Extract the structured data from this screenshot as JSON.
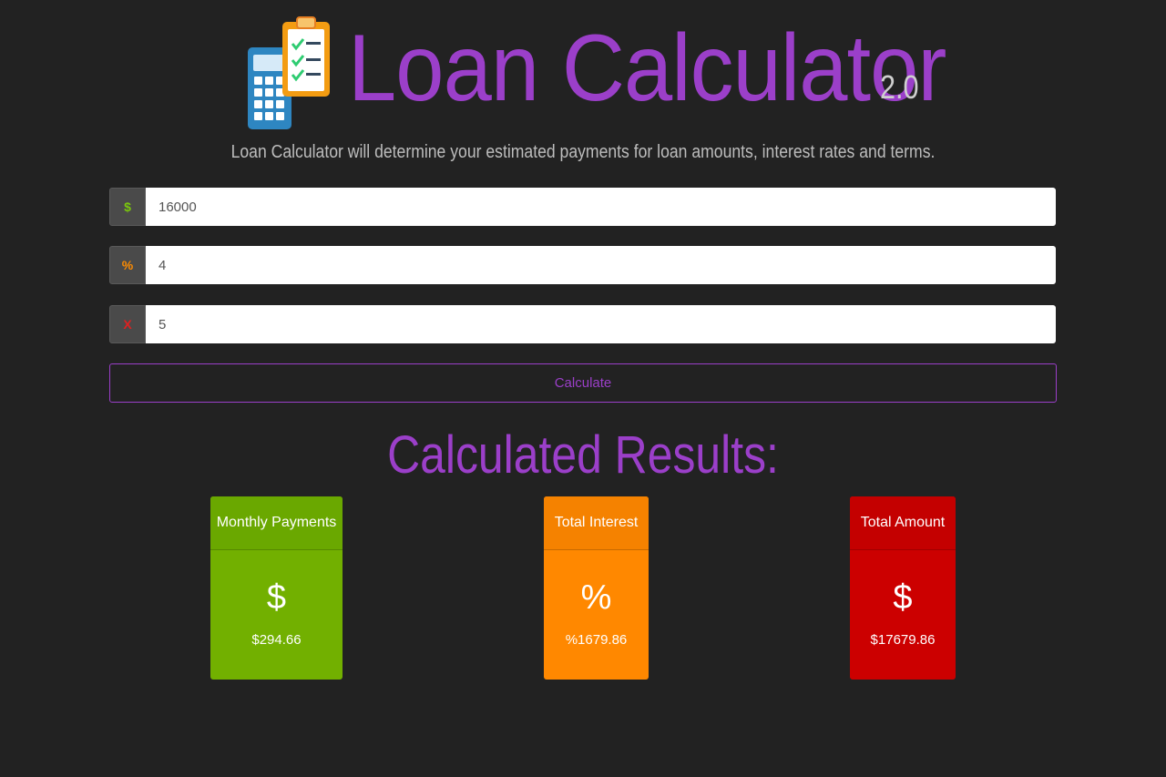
{
  "header": {
    "title": "Loan Calculator",
    "version": "2.0",
    "subtitle": "Loan Calculator will determine your estimated payments for loan amounts, interest rates and terms.",
    "logo_icon": "calculator-clipboard-icon"
  },
  "form": {
    "amount": {
      "addon": "$",
      "value": "16000"
    },
    "rate": {
      "addon": "%",
      "value": "4"
    },
    "term": {
      "addon": "X",
      "value": "5"
    },
    "calculate_label": "Calculate"
  },
  "results": {
    "title": "Calculated Results:",
    "cards": [
      {
        "label": "Monthly Payments",
        "symbol": "$",
        "value": "$294.66",
        "color": "#72b000"
      },
      {
        "label": "Total Interest",
        "symbol": "%",
        "value": "%1679.86",
        "color": "#ff8800"
      },
      {
        "label": "Total Amount",
        "symbol": "$",
        "value": "$17679.86",
        "color": "#cc0000"
      }
    ]
  },
  "colors": {
    "background": "#222222",
    "accent": "#9b3fc9",
    "green": "#7ac70c",
    "orange": "#ff8c00",
    "red": "#e02020"
  }
}
